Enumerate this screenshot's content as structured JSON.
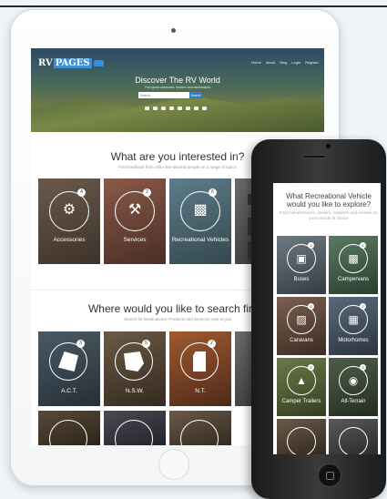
{
  "colors": {
    "accent": "#3a8fd6",
    "button": "#2a7fc9"
  },
  "brand": {
    "rv": "RV",
    "pages": "PAGES"
  },
  "nav": [
    "Home",
    "About",
    "Blog",
    "Login",
    "Register"
  ],
  "hero": {
    "title": "Discover The RV World",
    "subtitle": "Find great campsites, dealers and destinations",
    "search_placeholder": "Search...",
    "search_button": "Search",
    "category_icons": [
      "bus-icon",
      "caravan-icon",
      "camper-icon",
      "motorhome-icon",
      "trailer-icon",
      "terrain-icon",
      "accessory-icon",
      "service-icon"
    ]
  },
  "interests": {
    "title": "What are you interested in?",
    "subtitle": "Find feedback from other like-minded people on a range of topics",
    "tiles": [
      {
        "label": "Accessories",
        "badge": "4",
        "icon": "generator-icon",
        "color": "#5c4a3d"
      },
      {
        "label": "Services",
        "badge": "2",
        "icon": "wrench-icon",
        "color": "#7a4b3a"
      },
      {
        "label": "Recreational Vehicles",
        "badge": "6",
        "icon": "caravan-icon",
        "color": "#4d6a7a"
      }
    ]
  },
  "search_first": {
    "title": "Where would you like to search first?",
    "subtitle": "Search for Destinations, Products and Services near to you",
    "tiles": [
      {
        "label": "A.C.T.",
        "badge": "3",
        "color": "#3c4a55"
      },
      {
        "label": "N.S.W.",
        "badge": "5",
        "color": "#5a4a3a"
      },
      {
        "label": "N.T.",
        "badge": "2",
        "color": "#8a4a2a"
      }
    ]
  },
  "phone": {
    "title": "What Recreational Vehicle would you like to explore?",
    "subtitle": "Find manufacturers, dealers, repairers and reviews for your vehicle of choice",
    "tiles": [
      {
        "label": "Buses",
        "badge": "3",
        "icon": "bus-icon",
        "color": "#5e6a72"
      },
      {
        "label": "Campervans",
        "badge": "4",
        "icon": "campervan-icon",
        "color": "#4a6a55"
      },
      {
        "label": "Caravans",
        "badge": "6",
        "icon": "caravan-icon",
        "color": "#6a5040"
      },
      {
        "label": "Motorhomes",
        "badge": "2",
        "icon": "motorhome-icon",
        "color": "#4a5a6a"
      },
      {
        "label": "Camper Trailers",
        "badge": "5",
        "icon": "camper-trailer-icon",
        "color": "#5a6a40"
      },
      {
        "label": "All-Terrain",
        "badge": "3",
        "icon": "terrain-icon",
        "color": "#3e4e3a"
      }
    ]
  }
}
